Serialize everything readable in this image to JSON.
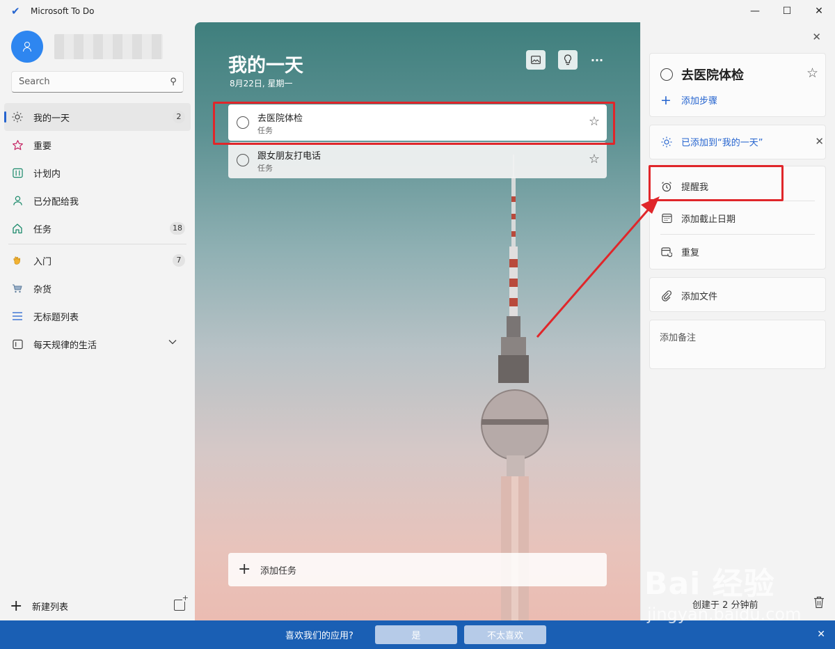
{
  "window": {
    "title": "Microsoft To Do",
    "icon": "check-icon"
  },
  "sidebar": {
    "search_placeholder": "Search",
    "items": [
      {
        "label": "我的一天",
        "icon": "sun-icon",
        "count": "2",
        "active": true
      },
      {
        "label": "重要",
        "icon": "star-icon",
        "count": ""
      },
      {
        "label": "计划内",
        "icon": "calendar-grid-icon",
        "count": ""
      },
      {
        "label": "已分配给我",
        "icon": "person-icon",
        "count": ""
      },
      {
        "label": "任务",
        "icon": "home-icon",
        "count": "18"
      }
    ],
    "lists": [
      {
        "label": "入门",
        "icon": "waving-hand-icon",
        "count": "7"
      },
      {
        "label": "杂货",
        "icon": "shopping-cart-icon",
        "count": ""
      },
      {
        "label": "无标题列表",
        "icon": "list-lines-icon",
        "count": ""
      },
      {
        "label": "每天规律的生活",
        "icon": "group-icon",
        "count": ""
      }
    ],
    "new_list_label": "新建列表"
  },
  "main": {
    "title": "我的一天",
    "date": "8月22日, 星期一",
    "tasks": [
      {
        "title": "去医院体检",
        "subtitle": "任务"
      },
      {
        "title": "跟女朋友打电话",
        "subtitle": "任务"
      }
    ],
    "add_task_label": "添加任务"
  },
  "detail": {
    "task_title": "去医院体检",
    "add_step_label": "添加步骤",
    "my_day_label": "已添加到“我的一天”",
    "remind_label": "提醒我",
    "due_label": "添加截止日期",
    "repeat_label": "重复",
    "file_label": "添加文件",
    "note_placeholder": "添加备注",
    "created_text": "创建于 2 分钟前"
  },
  "feedback": {
    "question": "喜欢我们的应用?",
    "yes_label": "是",
    "no_label": "不太喜欢"
  },
  "watermark": {
    "text": "Bai 经验",
    "sub": "jingyan.baidu.com"
  },
  "colors": {
    "accent": "#2564cf",
    "annotation": "#e0262a",
    "feedback_bar": "#1a5fb4"
  }
}
